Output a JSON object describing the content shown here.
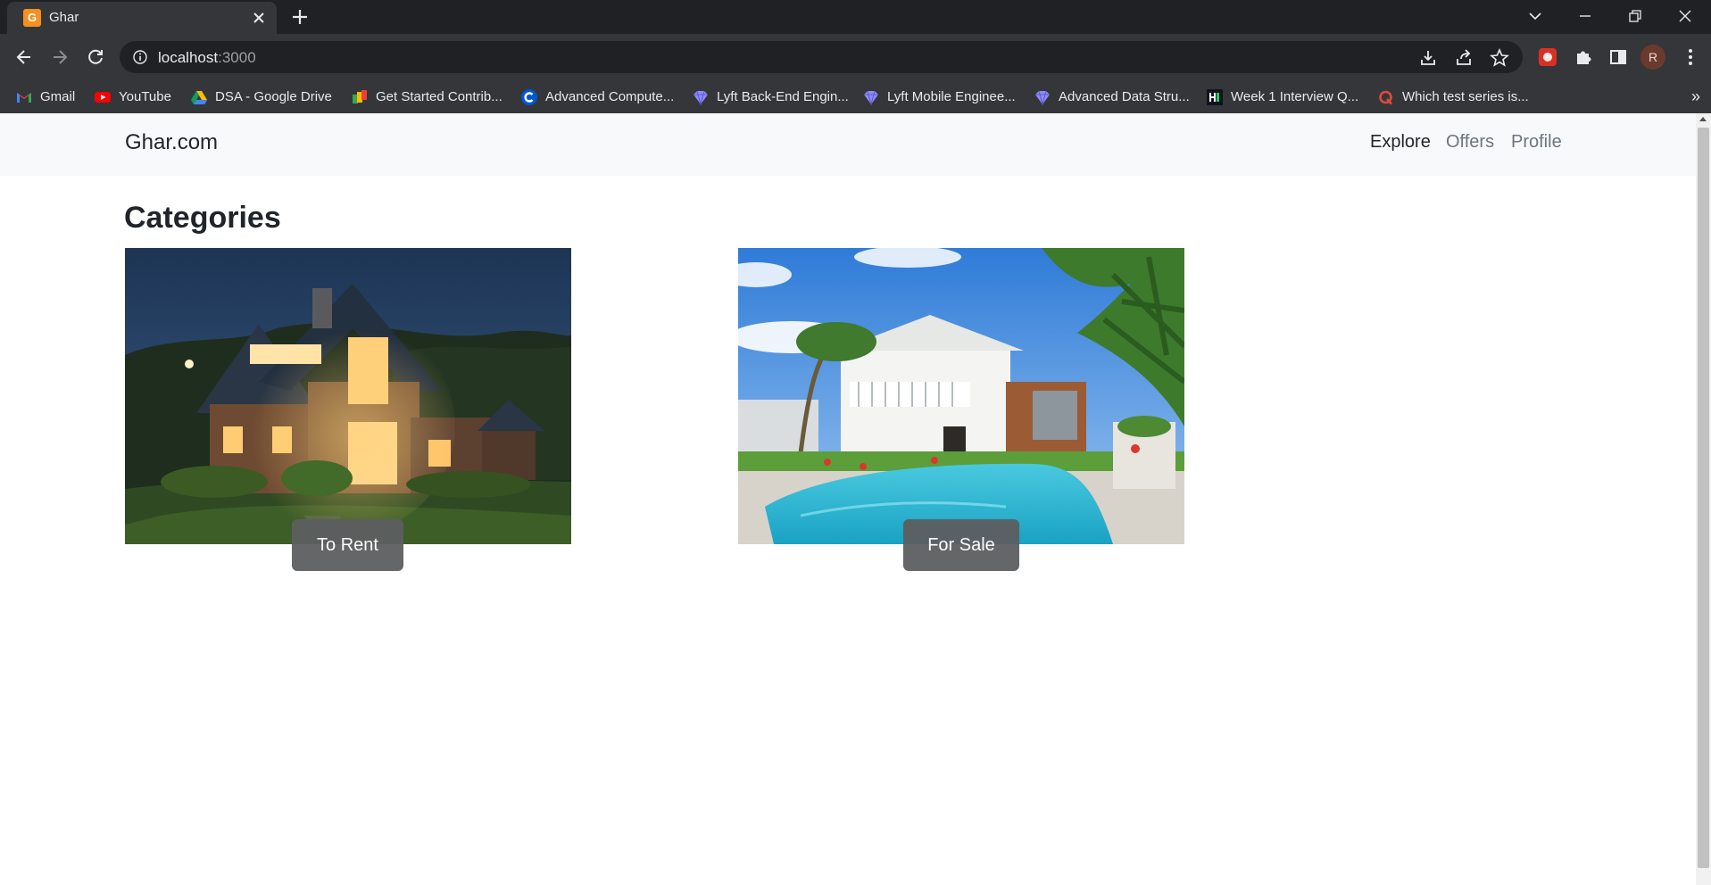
{
  "browser": {
    "tab_title": "Ghar",
    "tab_favicon_letter": "G",
    "url_host": "localhost",
    "url_port": ":3000",
    "avatar_letter": "R"
  },
  "bookmarks": [
    {
      "label": "Gmail",
      "icon": "gmail-icon"
    },
    {
      "label": "YouTube",
      "icon": "youtube-icon"
    },
    {
      "label": "DSA - Google Drive",
      "icon": "google-drive-icon"
    },
    {
      "label": "Get Started Contrib...",
      "icon": "contrib-icon"
    },
    {
      "label": "Advanced Compute...",
      "icon": "coursera-icon"
    },
    {
      "label": "Lyft Back-End Engin...",
      "icon": "forage-icon"
    },
    {
      "label": "Lyft Mobile Enginee...",
      "icon": "forage-icon"
    },
    {
      "label": "Advanced Data Stru...",
      "icon": "forage-icon"
    },
    {
      "label": "Week 1 Interview Q...",
      "icon": "hackerrank-icon"
    },
    {
      "label": "Which test series is...",
      "icon": "quora-icon"
    }
  ],
  "navbar": {
    "brand": "Ghar.com",
    "links": [
      {
        "label": "Explore",
        "active": true
      },
      {
        "label": "Offers",
        "active": false
      },
      {
        "label": "Profile",
        "active": false
      }
    ]
  },
  "page": {
    "heading": "Categories",
    "categories": [
      {
        "label": "To Rent",
        "image": "house-at-dusk-photo"
      },
      {
        "label": "For Sale",
        "image": "house-with-pool-photo"
      }
    ]
  },
  "colors": {
    "chrome_dark": "#202124",
    "chrome_toolbar": "#35363a",
    "navbar_bg": "#f8f9fa",
    "text_dark": "#212529",
    "text_muted": "#6c757d",
    "category_button": "#5c5e60"
  }
}
